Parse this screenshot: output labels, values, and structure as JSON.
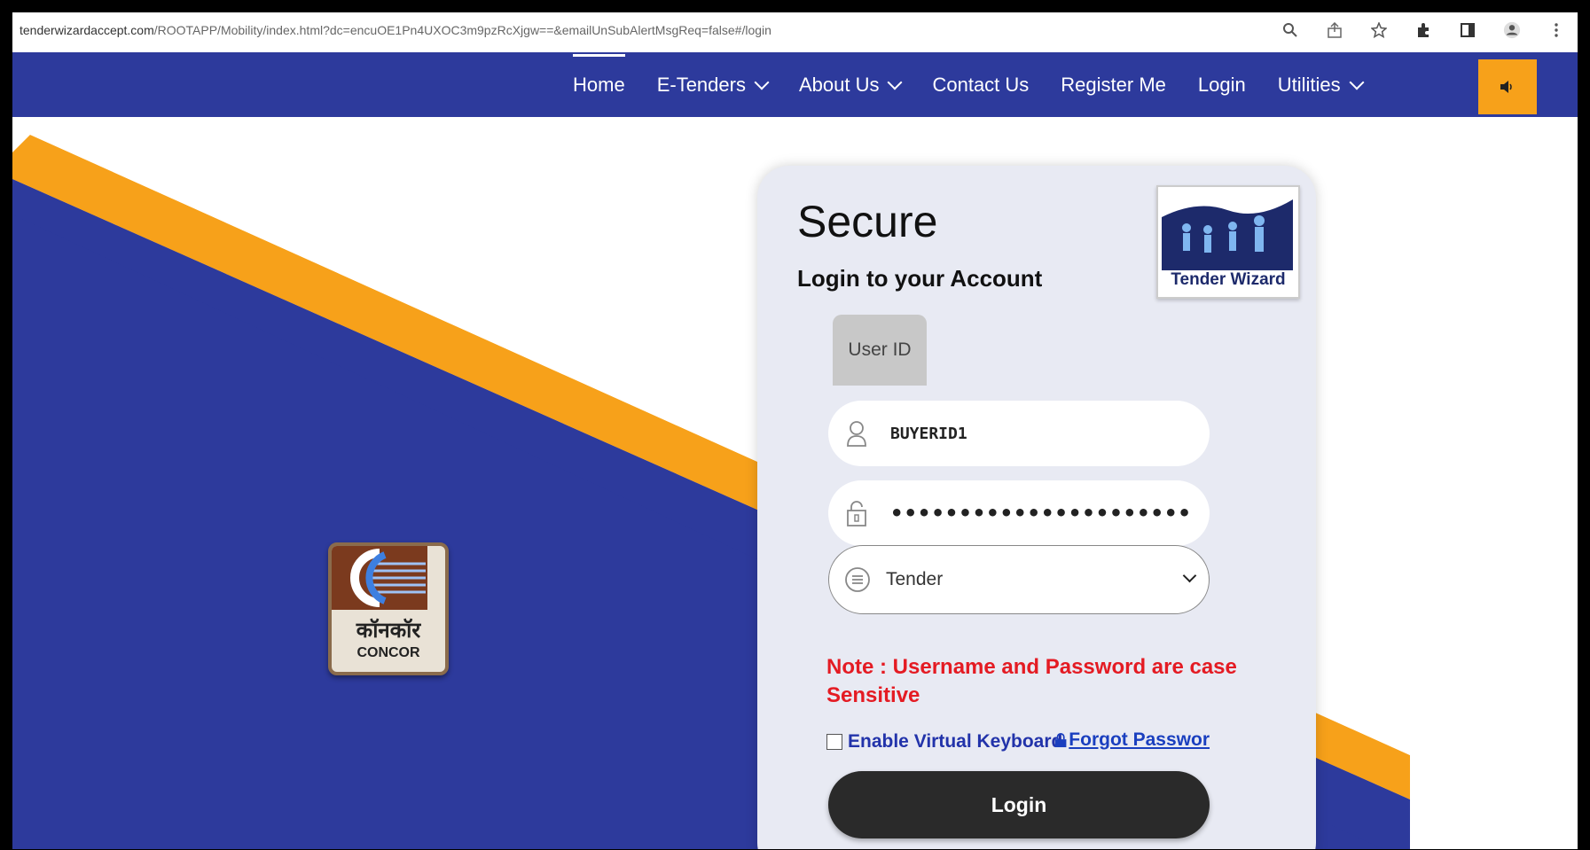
{
  "browser": {
    "url_host": "tenderwizardaccept.com",
    "url_path": "/ROOTAPP/Mobility/index.html?dc=encuOE1Pn4UXOC3m9pzRcXjgw==&emailUnSubAlertMsgReq=false#/login",
    "icons": [
      "zoom-icon",
      "share-icon",
      "star-icon",
      "extensions-icon",
      "sidepanel-icon",
      "profile-icon",
      "menu-icon"
    ]
  },
  "nav": {
    "items": [
      {
        "label": "Home",
        "dropdown": false,
        "active": true
      },
      {
        "label": "E-Tenders",
        "dropdown": true,
        "active": false
      },
      {
        "label": "About Us",
        "dropdown": true,
        "active": false
      },
      {
        "label": "Contact Us",
        "dropdown": false,
        "active": false
      },
      {
        "label": "Register Me",
        "dropdown": false,
        "active": false
      },
      {
        "label": "Login",
        "dropdown": false,
        "active": false
      },
      {
        "label": "Utilities",
        "dropdown": true,
        "active": false
      }
    ],
    "speaker_icon": "speaker-icon"
  },
  "logo": {
    "hindi": "कॉनकॉर",
    "english": "CONCOR"
  },
  "login": {
    "title": "Secure",
    "subtitle": "Login to your Account",
    "tw_logo_text": "Tender Wizard",
    "user_id_tab": "User ID",
    "username_value": "BUYERID1",
    "password_value": "••••••••••••••••••••••••••••••",
    "select_value": "Tender",
    "note": "Note : Username and Password are case Sensitive",
    "virtual_keyboard_label": "Enable Virtual Keyboard",
    "forgot_password_label": "Forgot Passwor",
    "login_button": "Login"
  },
  "colors": {
    "nav_bg": "#2d3a9c",
    "accent_orange": "#f7a11a",
    "note_red": "#e41b23",
    "link_blue": "#1a3fbf"
  }
}
